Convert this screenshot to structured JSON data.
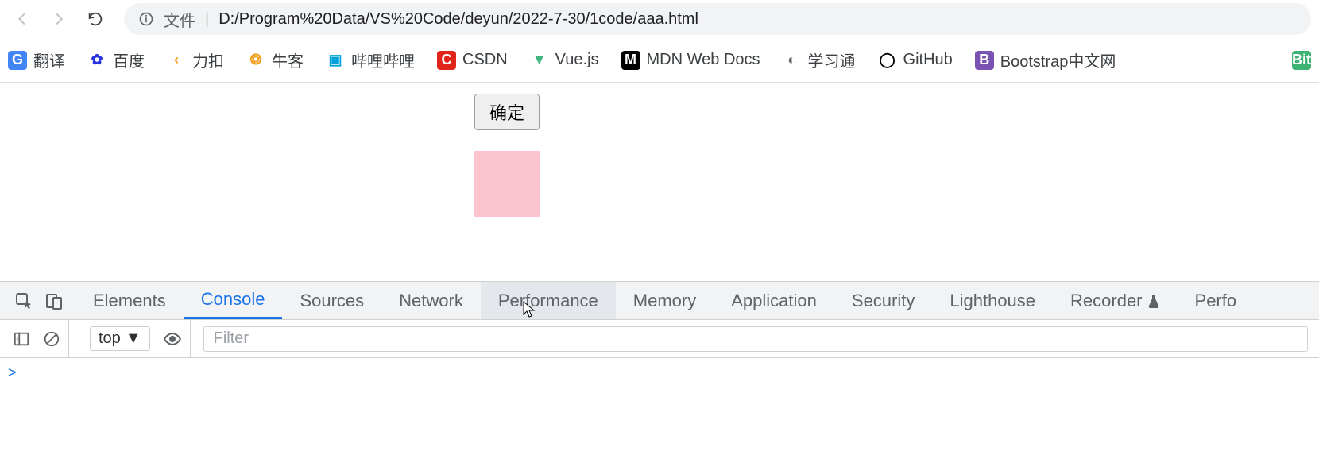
{
  "toolbar": {
    "file_label": "文件",
    "url": "D:/Program%20Data/VS%20Code/deyun/2022-7-30/1code/aaa.html"
  },
  "bookmarks": [
    {
      "label": "翻译",
      "icon_bg": "#4285f4",
      "icon_fg": "#fff",
      "icon_text": "G"
    },
    {
      "label": "百度",
      "icon_bg": "#fff",
      "icon_fg": "#2932e1",
      "icon_text": "✿"
    },
    {
      "label": "力扣",
      "icon_bg": "#fff",
      "icon_fg": "#f89f1b",
      "icon_text": "‹"
    },
    {
      "label": "牛客",
      "icon_bg": "#fff",
      "icon_fg": "#f0a020",
      "icon_text": "❂"
    },
    {
      "label": "哔哩哔哩",
      "icon_bg": "#fff",
      "icon_fg": "#00a1d6",
      "icon_text": "▣"
    },
    {
      "label": "CSDN",
      "icon_bg": "#e1251b",
      "icon_fg": "#fff",
      "icon_text": "C"
    },
    {
      "label": "Vue.js",
      "icon_bg": "#fff",
      "icon_fg": "#41b883",
      "icon_text": "▼"
    },
    {
      "label": "MDN Web Docs",
      "icon_bg": "#000",
      "icon_fg": "#fff",
      "icon_text": "M"
    },
    {
      "label": "学习通",
      "icon_bg": "#fff",
      "icon_fg": "#5f6368",
      "icon_text": "◐"
    },
    {
      "label": "GitHub",
      "icon_bg": "#fff",
      "icon_fg": "#000",
      "icon_text": "◯"
    },
    {
      "label": "Bootstrap中文网",
      "icon_bg": "#7952b3",
      "icon_fg": "#fff",
      "icon_text": "B"
    }
  ],
  "bookmark_overflow_icon_bg": "#3cb371",
  "bookmark_overflow_icon_text": "Bit",
  "page": {
    "button_label": "确定",
    "box_color": "#fbc4cf"
  },
  "devtools": {
    "tabs": [
      "Elements",
      "Console",
      "Sources",
      "Network",
      "Performance",
      "Memory",
      "Application",
      "Security",
      "Lighthouse",
      "Recorder",
      "Perfo"
    ],
    "active_tab_index": 1,
    "hover_tab_index": 4,
    "recorder_tab_index": 9,
    "context_label": "top",
    "filter_placeholder": "Filter",
    "prompt": ">"
  }
}
